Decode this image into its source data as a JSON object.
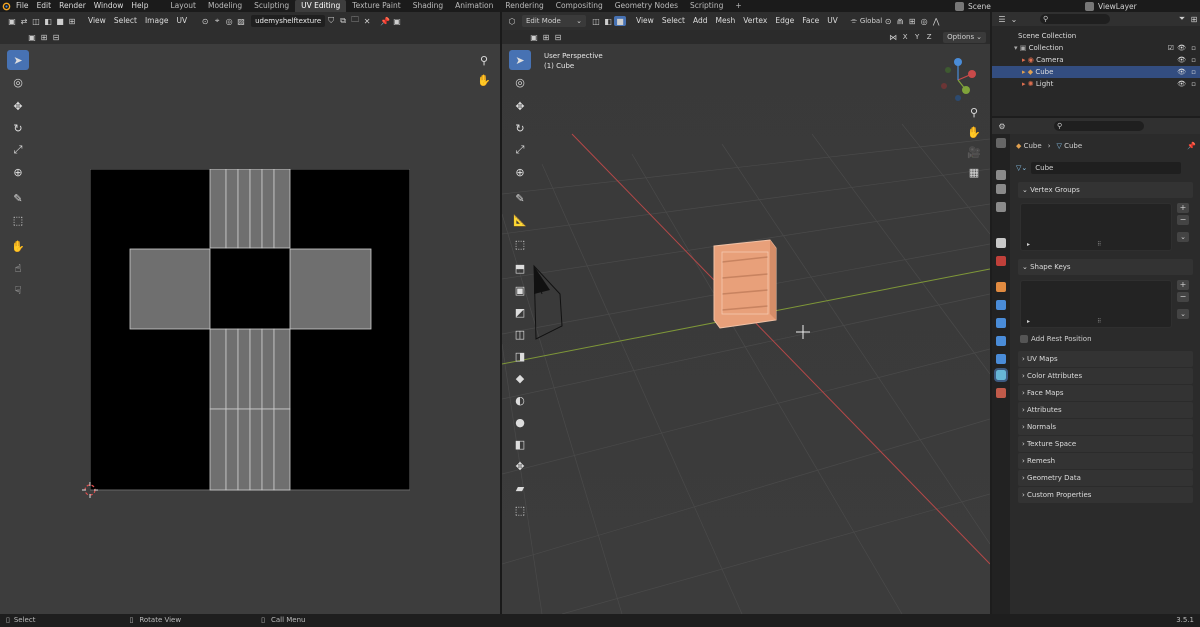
{
  "menu": [
    "File",
    "Edit",
    "Render",
    "Window",
    "Help"
  ],
  "workspace_tabs": [
    "Layout",
    "Modeling",
    "Sculpting",
    "UV Editing",
    "Texture Paint",
    "Shading",
    "Animation",
    "Rendering",
    "Compositing",
    "Geometry Nodes",
    "Scripting"
  ],
  "active_workspace": "UV Editing",
  "scene": "Scene",
  "view_layer": "ViewLayer",
  "uv_editor": {
    "menus": [
      "View",
      "Select",
      "Image",
      "UV"
    ],
    "image_name": "udemyshelftexture"
  },
  "viewport": {
    "mode": "Edit Mode",
    "menus": [
      "View",
      "Select",
      "Add",
      "Mesh",
      "Vertex",
      "Edge",
      "Face",
      "UV"
    ],
    "transform_orientation": "Global",
    "axes": [
      "X",
      "Y",
      "Z"
    ],
    "options_label": "Options",
    "info_line1": "User Perspective",
    "info_line2": "(1) Cube"
  },
  "outliner": {
    "root": "Scene Collection",
    "collection": "Collection",
    "objects": [
      "Camera",
      "Cube",
      "Light"
    ],
    "selected": "Cube"
  },
  "properties": {
    "breadcrumb_object": "Cube",
    "breadcrumb_data": "Cube",
    "data_name": "Cube",
    "vertex_groups": "Vertex Groups",
    "shape_keys": "Shape Keys",
    "add_rest_position": "Add Rest Position",
    "panels": [
      "UV Maps",
      "Color Attributes",
      "Face Maps",
      "Attributes",
      "Normals",
      "Texture Space",
      "Remesh",
      "Geometry Data",
      "Custom Properties"
    ]
  },
  "status": {
    "select": "Select",
    "rotate": "Rotate View",
    "call_menu": "Call Menu",
    "version": "3.5.1"
  },
  "colors": {
    "accent": "#4772b3",
    "selected_row": "#334d80",
    "cube_orange": "#e8a07a",
    "x_axis": "#c24a4a",
    "y_axis": "#8aa03a"
  }
}
